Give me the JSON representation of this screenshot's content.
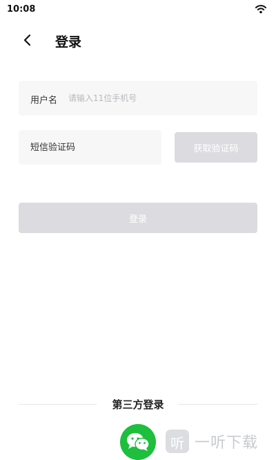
{
  "status_bar": {
    "time": "10:08",
    "wifi_icon": "wifi-icon"
  },
  "header": {
    "back_icon": "chevron-left-icon",
    "title": "登录"
  },
  "form": {
    "username": {
      "label": "用户名",
      "placeholder": "请输入11位手机号",
      "value": ""
    },
    "code": {
      "placeholder": "短信验证码",
      "value": ""
    },
    "get_code_label": "获取验证码",
    "login_label": "登录"
  },
  "third_party": {
    "title": "第三方登录",
    "wechat_icon": "wechat-icon"
  },
  "watermark": {
    "logo_char": "听",
    "text": "一听下载"
  },
  "colors": {
    "wechat": "#1dbf3c",
    "disabled_button": "#dcdce0",
    "field_bg": "#f7f7f8"
  }
}
